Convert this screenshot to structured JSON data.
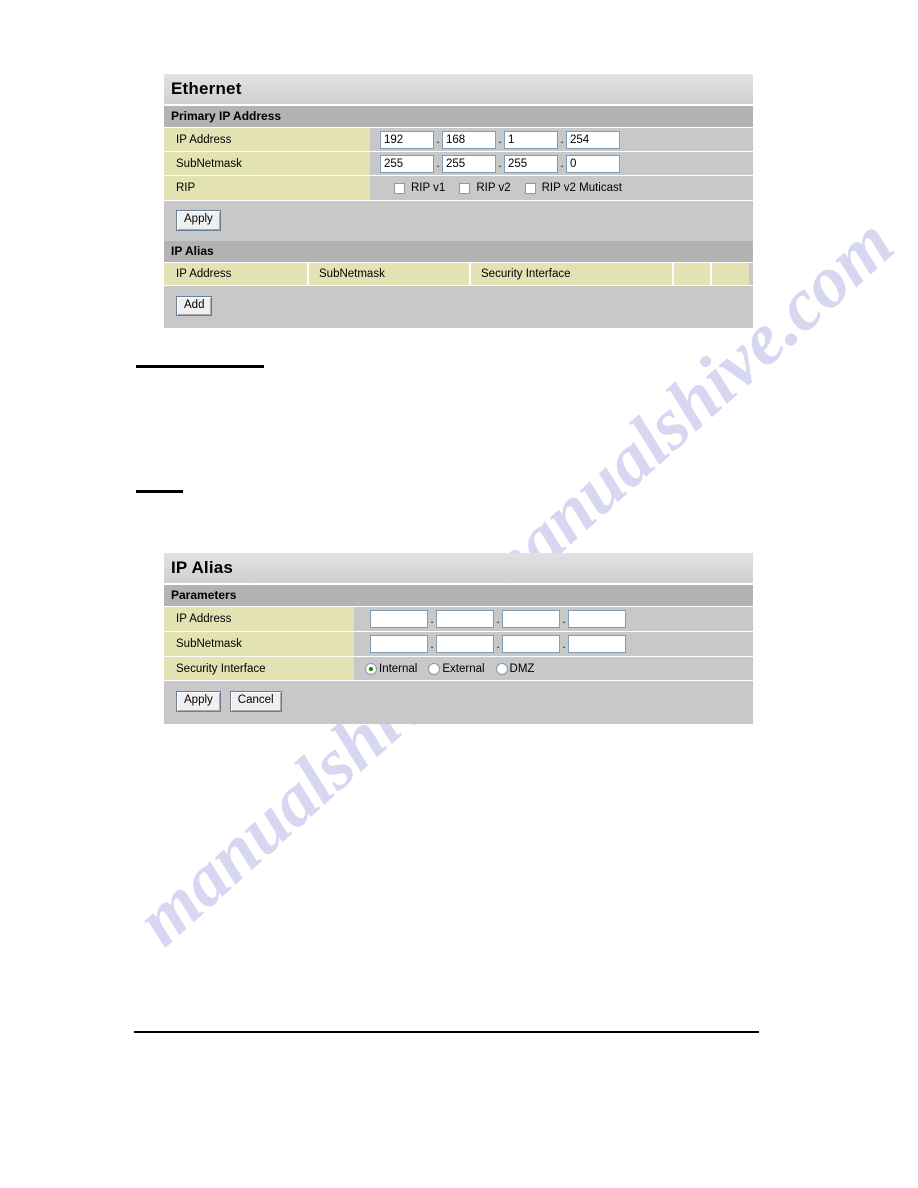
{
  "watermark": {
    "line_a": "manualshive.com",
    "line_b": "manualshive.com"
  },
  "ethernet_panel": {
    "title": "Ethernet",
    "subtitle": "Primary IP Address",
    "rows": {
      "ip_address_label": "IP Address",
      "ip_address_octets": [
        "192",
        "168",
        "1",
        "254"
      ],
      "subnetmask_label": "SubNetmask",
      "subnetmask_octets": [
        "255",
        "255",
        "255",
        "0"
      ],
      "rip_label": "RIP",
      "rip_options": [
        {
          "label": "RIP v1",
          "checked": false
        },
        {
          "label": "RIP v2",
          "checked": false
        },
        {
          "label": "RIP v2 Muticast",
          "checked": false
        }
      ]
    },
    "apply_label": "Apply",
    "alias_subtitle": "IP Alias",
    "alias_table_headers": [
      "IP Address",
      "SubNetmask",
      "Security Interface",
      "",
      ""
    ],
    "add_label": "Add"
  },
  "ipalias_panel": {
    "title": "IP Alias",
    "subtitle": "Parameters",
    "rows": {
      "ip_address_label": "IP Address",
      "ip_address_octets": [
        "",
        "",
        "",
        ""
      ],
      "subnetmask_label": "SubNetmask",
      "subnetmask_octets": [
        "",
        "",
        "",
        ""
      ],
      "security_interface_label": "Security Interface",
      "security_interface_options": [
        {
          "label": "Internal",
          "checked": true
        },
        {
          "label": "External",
          "checked": false
        },
        {
          "label": "DMZ",
          "checked": false
        }
      ]
    },
    "apply_label": "Apply",
    "cancel_label": "Cancel"
  },
  "colors": {
    "label_bg": "#e2e2b2",
    "panel_bg": "#c8c8c8",
    "subtitle_bg": "#b3b3b3",
    "input_border": "#7f9db9",
    "radio_dot": "#0a8a0a",
    "watermark": "#d7d7f2"
  }
}
